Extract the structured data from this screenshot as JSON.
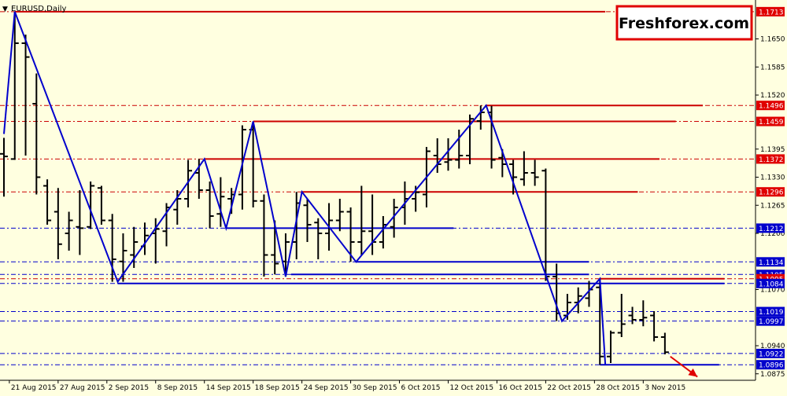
{
  "symbol_label": "EURUSD,Daily",
  "symbol_menu_glyph": "▼",
  "brand": "Freshforex.com",
  "colors": {
    "background": "#ffffe0",
    "axis": "#000000",
    "bar": "#000000",
    "zigzag": "#0000cc",
    "resistance": "#cc0000",
    "support": "#0000cc",
    "price_tag_red": "#e00000",
    "price_tag_blue": "#0000cc",
    "arrow": "#e00000"
  },
  "chart_data": {
    "type": "ohlc",
    "symbol": "EURUSD",
    "timeframe": "Daily",
    "ylim": [
      1.086,
      1.174
    ],
    "xlim": [
      0,
      138
    ],
    "y_ticks": [
      "1.1650",
      "1.1585",
      "1.1520",
      "1.1395",
      "1.1330",
      "1.1265",
      "1.1200",
      "1.1070",
      "1.0940",
      "1.0875"
    ],
    "x_ticks": [
      {
        "label": "21 Aug 2015",
        "x": 1
      },
      {
        "label": "27 Aug 2015",
        "x": 10
      },
      {
        "label": "2 Sep 2015",
        "x": 19
      },
      {
        "label": "8 Sep 2015",
        "x": 28
      },
      {
        "label": "14 Sep 2015",
        "x": 37
      },
      {
        "label": "18 Sep 2015",
        "x": 46
      },
      {
        "label": "24 Sep 2015",
        "x": 55
      },
      {
        "label": "30 Sep 2015",
        "x": 64
      },
      {
        "label": "6 Oct 2015",
        "x": 73
      },
      {
        "label": "12 Oct 2015",
        "x": 82
      },
      {
        "label": "16 Oct 2015",
        "x": 91
      },
      {
        "label": "22 Oct 2015",
        "x": 100
      },
      {
        "label": "28 Oct 2015",
        "x": 109
      },
      {
        "label": "3 Nov 2015",
        "x": 118
      }
    ],
    "bars": [
      {
        "x": 0,
        "o": 1.1384,
        "h": 1.1421,
        "l": 1.1285,
        "c": 1.1378
      },
      {
        "x": 2,
        "o": 1.1372,
        "h": 1.1713,
        "l": 1.137,
        "c": 1.164
      },
      {
        "x": 4,
        "o": 1.164,
        "h": 1.166,
        "l": 1.138,
        "c": 1.1608
      },
      {
        "x": 6,
        "o": 1.15,
        "h": 1.157,
        "l": 1.129,
        "c": 1.133
      },
      {
        "x": 8,
        "o": 1.131,
        "h": 1.1325,
        "l": 1.122,
        "c": 1.123
      },
      {
        "x": 10,
        "o": 1.125,
        "h": 1.1305,
        "l": 1.114,
        "c": 1.1175
      },
      {
        "x": 12,
        "o": 1.12,
        "h": 1.125,
        "l": 1.116,
        "c": 1.123
      },
      {
        "x": 14,
        "o": 1.1215,
        "h": 1.13,
        "l": 1.115,
        "c": 1.1212
      },
      {
        "x": 16,
        "o": 1.1215,
        "h": 1.132,
        "l": 1.121,
        "c": 1.131
      },
      {
        "x": 18,
        "o": 1.1305,
        "h": 1.131,
        "l": 1.122,
        "c": 1.123
      },
      {
        "x": 20,
        "o": 1.123,
        "h": 1.1245,
        "l": 1.1088,
        "c": 1.114
      },
      {
        "x": 22,
        "o": 1.1135,
        "h": 1.12,
        "l": 1.1088,
        "c": 1.116
      },
      {
        "x": 24,
        "o": 1.115,
        "h": 1.1215,
        "l": 1.112,
        "c": 1.118
      },
      {
        "x": 26,
        "o": 1.117,
        "h": 1.1225,
        "l": 1.115,
        "c": 1.1195
      },
      {
        "x": 28,
        "o": 1.12,
        "h": 1.1235,
        "l": 1.113,
        "c": 1.121
      },
      {
        "x": 30,
        "o": 1.1205,
        "h": 1.127,
        "l": 1.117,
        "c": 1.126
      },
      {
        "x": 32,
        "o": 1.1255,
        "h": 1.13,
        "l": 1.122,
        "c": 1.128
      },
      {
        "x": 34,
        "o": 1.128,
        "h": 1.137,
        "l": 1.126,
        "c": 1.1345
      },
      {
        "x": 36,
        "o": 1.134,
        "h": 1.1372,
        "l": 1.128,
        "c": 1.13
      },
      {
        "x": 38,
        "o": 1.13,
        "h": 1.132,
        "l": 1.1212,
        "c": 1.124
      },
      {
        "x": 40,
        "o": 1.1245,
        "h": 1.133,
        "l": 1.1215,
        "c": 1.1285
      },
      {
        "x": 42,
        "o": 1.128,
        "h": 1.1305,
        "l": 1.1245,
        "c": 1.129
      },
      {
        "x": 44,
        "o": 1.129,
        "h": 1.145,
        "l": 1.1255,
        "c": 1.144
      },
      {
        "x": 46,
        "o": 1.144,
        "h": 1.1459,
        "l": 1.126,
        "c": 1.1275
      },
      {
        "x": 48,
        "o": 1.1275,
        "h": 1.129,
        "l": 1.11,
        "c": 1.115
      },
      {
        "x": 50,
        "o": 1.115,
        "h": 1.123,
        "l": 1.1105,
        "c": 1.113
      },
      {
        "x": 52,
        "o": 1.1135,
        "h": 1.12,
        "l": 1.11,
        "c": 1.118
      },
      {
        "x": 54,
        "o": 1.118,
        "h": 1.1296,
        "l": 1.114,
        "c": 1.127
      },
      {
        "x": 56,
        "o": 1.1265,
        "h": 1.128,
        "l": 1.118,
        "c": 1.122
      },
      {
        "x": 58,
        "o": 1.1225,
        "h": 1.1235,
        "l": 1.114,
        "c": 1.12
      },
      {
        "x": 60,
        "o": 1.12,
        "h": 1.127,
        "l": 1.116,
        "c": 1.123
      },
      {
        "x": 62,
        "o": 1.123,
        "h": 1.128,
        "l": 1.1205,
        "c": 1.125
      },
      {
        "x": 64,
        "o": 1.125,
        "h": 1.126,
        "l": 1.1134,
        "c": 1.118
      },
      {
        "x": 66,
        "o": 1.118,
        "h": 1.131,
        "l": 1.115,
        "c": 1.1205
      },
      {
        "x": 68,
        "o": 1.1205,
        "h": 1.129,
        "l": 1.115,
        "c": 1.118
      },
      {
        "x": 70,
        "o": 1.118,
        "h": 1.124,
        "l": 1.1165,
        "c": 1.122
      },
      {
        "x": 72,
        "o": 1.1215,
        "h": 1.128,
        "l": 1.119,
        "c": 1.126
      },
      {
        "x": 74,
        "o": 1.126,
        "h": 1.132,
        "l": 1.122,
        "c": 1.128
      },
      {
        "x": 76,
        "o": 1.128,
        "h": 1.131,
        "l": 1.125,
        "c": 1.1295
      },
      {
        "x": 78,
        "o": 1.129,
        "h": 1.14,
        "l": 1.126,
        "c": 1.139
      },
      {
        "x": 80,
        "o": 1.138,
        "h": 1.142,
        "l": 1.134,
        "c": 1.136
      },
      {
        "x": 82,
        "o": 1.1365,
        "h": 1.142,
        "l": 1.1345,
        "c": 1.137
      },
      {
        "x": 84,
        "o": 1.137,
        "h": 1.144,
        "l": 1.135,
        "c": 1.138
      },
      {
        "x": 86,
        "o": 1.138,
        "h": 1.1475,
        "l": 1.136,
        "c": 1.1465
      },
      {
        "x": 88,
        "o": 1.146,
        "h": 1.1496,
        "l": 1.144,
        "c": 1.148
      },
      {
        "x": 90,
        "o": 1.148,
        "h": 1.1495,
        "l": 1.135,
        "c": 1.137
      },
      {
        "x": 92,
        "o": 1.1375,
        "h": 1.1395,
        "l": 1.133,
        "c": 1.136
      },
      {
        "x": 94,
        "o": 1.136,
        "h": 1.137,
        "l": 1.129,
        "c": 1.133
      },
      {
        "x": 96,
        "o": 1.1325,
        "h": 1.139,
        "l": 1.131,
        "c": 1.134
      },
      {
        "x": 98,
        "o": 1.134,
        "h": 1.137,
        "l": 1.131,
        "c": 1.133
      },
      {
        "x": 100,
        "o": 1.1345,
        "h": 1.135,
        "l": 1.109,
        "c": 1.11
      },
      {
        "x": 102,
        "o": 1.11,
        "h": 1.113,
        "l": 1.0997,
        "c": 1.1015
      },
      {
        "x": 104,
        "o": 1.101,
        "h": 1.106,
        "l": 1.1,
        "c": 1.104
      },
      {
        "x": 106,
        "o": 1.104,
        "h": 1.1075,
        "l": 1.1015,
        "c": 1.1055
      },
      {
        "x": 108,
        "o": 1.105,
        "h": 1.109,
        "l": 1.103,
        "c": 1.107
      },
      {
        "x": 110,
        "o": 1.1075,
        "h": 1.1095,
        "l": 1.0896,
        "c": 1.0915
      },
      {
        "x": 112,
        "o": 1.0915,
        "h": 1.0975,
        "l": 1.09,
        "c": 1.097
      },
      {
        "x": 114,
        "o": 1.097,
        "h": 1.106,
        "l": 1.096,
        "c": 1.099
      },
      {
        "x": 116,
        "o": 1.101,
        "h": 1.103,
        "l": 1.099,
        "c": 1.1
      },
      {
        "x": 118,
        "o": 1.1,
        "h": 1.1045,
        "l": 1.0985,
        "c": 1.1005
      },
      {
        "x": 120,
        "o": 1.101,
        "h": 1.102,
        "l": 1.095,
        "c": 1.096
      },
      {
        "x": 122,
        "o": 1.096,
        "h": 1.097,
        "l": 1.092,
        "c": 1.0925
      }
    ],
    "zigzag": [
      {
        "x": 0,
        "y": 1.143
      },
      {
        "x": 2,
        "y": 1.1713
      },
      {
        "x": 21,
        "y": 1.1088
      },
      {
        "x": 37,
        "y": 1.1372
      },
      {
        "x": 41,
        "y": 1.1212
      },
      {
        "x": 46,
        "y": 1.1459
      },
      {
        "x": 52,
        "y": 1.11
      },
      {
        "x": 55,
        "y": 1.1296
      },
      {
        "x": 65,
        "y": 1.1134
      },
      {
        "x": 89,
        "y": 1.1496
      },
      {
        "x": 103,
        "y": 1.0997
      },
      {
        "x": 110,
        "y": 1.1095
      },
      {
        "x": 111,
        "y": 1.0896
      }
    ],
    "levels": [
      {
        "price": 1.1713,
        "label": "1.1713",
        "kind": "resistance",
        "x0": 2,
        "x1": 111
      },
      {
        "price": 1.1496,
        "label": "1.1496",
        "kind": "resistance",
        "x0": 89,
        "x1": 129
      },
      {
        "price": 1.1459,
        "label": "1.1459",
        "kind": "resistance",
        "x0": 46,
        "x1": 124
      },
      {
        "price": 1.1372,
        "label": "1.1372",
        "kind": "resistance",
        "x0": 37,
        "x1": 121
      },
      {
        "price": 1.1296,
        "label": "1.1296",
        "kind": "resistance",
        "x0": 55,
        "x1": 117
      },
      {
        "price": 1.1212,
        "label": "1.1212",
        "kind": "support",
        "x0": 41,
        "x1": 83
      },
      {
        "price": 1.1134,
        "label": "1.1134",
        "kind": "support",
        "x0": 65,
        "x1": 108
      },
      {
        "price": 1.1105,
        "label": "1.1105",
        "kind": "support",
        "x0": 53,
        "x1": 108
      },
      {
        "price": 1.1095,
        "label": "1.1095",
        "kind": "resistance",
        "x0": 110,
        "x1": 133
      },
      {
        "price": 1.1084,
        "label": "1.1084",
        "kind": "support",
        "x0": 21,
        "x1": 133
      },
      {
        "price": 1.1019,
        "label": "1.1019",
        "kind": "support",
        "x0": 0,
        "x1": 0
      },
      {
        "price": 1.0997,
        "label": "1.0997",
        "kind": "support",
        "x0": 0,
        "x1": 0
      },
      {
        "price": 1.0922,
        "label": "1.0922",
        "kind": "support",
        "x0": 0,
        "x1": 0
      },
      {
        "price": 1.0896,
        "label": "1.0896",
        "kind": "support",
        "x0": 110,
        "x1": 132
      }
    ],
    "forecast_arrow": {
      "from": {
        "x": 123,
        "y": 1.0915
      },
      "to": {
        "x": 128,
        "y": 1.0868
      }
    }
  }
}
